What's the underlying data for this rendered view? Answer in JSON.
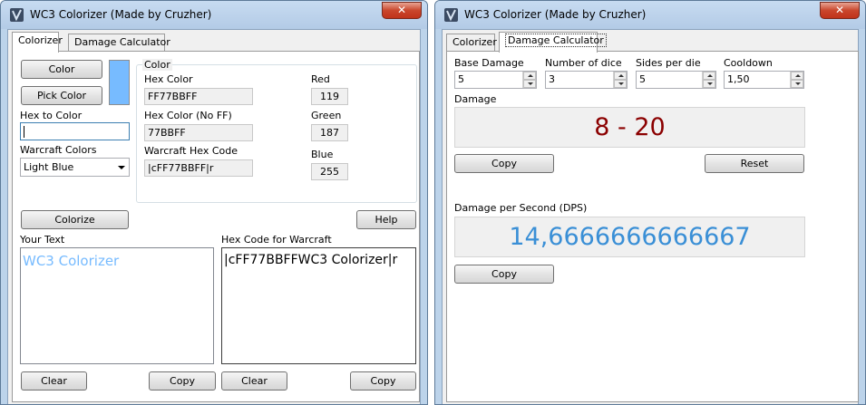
{
  "left_window": {
    "title": "WC3 Colorizer (Made by Cruzher)",
    "close_glyph": "✕",
    "tabs": [
      "Colorizer",
      "Damage Calculator"
    ],
    "color_button": "Color",
    "pick_color_button": "Pick Color",
    "swatch_color": "#77BBFF",
    "hex_to_color_label": "Hex to Color",
    "hex_to_color_value": "",
    "warcraft_colors_label": "Warcraft Colors",
    "warcraft_colors_selected": "Light Blue",
    "color_group_title": "Color",
    "hex_color_label": "Hex Color",
    "hex_color_value": "FF77BBFF",
    "hex_noff_label": "Hex Color (No FF)",
    "hex_noff_value": "77BBFF",
    "warcraft_hex_label": "Warcraft Hex Code",
    "warcraft_hex_value": "|cFF77BBFF|r",
    "red_label": "Red",
    "red_value": "119",
    "green_label": "Green",
    "green_value": "187",
    "blue_label": "Blue",
    "blue_value": "255",
    "colorize_button": "Colorize",
    "help_button": "Help",
    "your_text_label": "Your Text",
    "your_text_value": "WC3 Colorizer",
    "your_text_color": "#77BBFF",
    "hex_for_warcraft_label": "Hex Code for Warcraft",
    "hex_for_warcraft_value": "|cFF77BBFFWC3 Colorizer|r",
    "clear_button": "Clear",
    "copy_button": "Copy"
  },
  "right_window": {
    "title": "WC3 Colorizer (Made by Cruzher)",
    "close_glyph": "✕",
    "tabs": [
      "Colorizer",
      "Damage Calculator"
    ],
    "base_damage_label": "Base Damage",
    "base_damage_value": "5",
    "num_dice_label": "Number of dice",
    "num_dice_value": "3",
    "sides_label": "Sides per die",
    "sides_value": "5",
    "cooldown_label": "Cooldown",
    "cooldown_value": "1,50",
    "damage_label": "Damage",
    "damage_value": "8 - 20",
    "damage_color": "#8b0000",
    "copy_button": "Copy",
    "reset_button": "Reset",
    "dps_label": "Damage per Second (DPS)",
    "dps_value": "14,6666666666667",
    "dps_color": "#3a8fd6"
  }
}
